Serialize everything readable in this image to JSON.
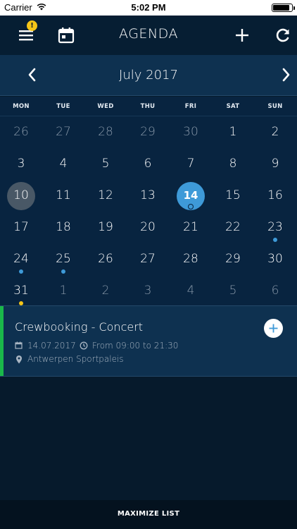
{
  "status_bar": {
    "carrier": "Carrier",
    "time": "5:02 PM"
  },
  "nav": {
    "title": "AGENDA",
    "badge": "!",
    "icons": [
      "menu-icon",
      "calendar-icon",
      "plus-icon",
      "refresh-icon"
    ]
  },
  "month": {
    "title": "July 2017"
  },
  "weekdays": [
    "MON",
    "TUE",
    "WED",
    "THU",
    "FRI",
    "SAT",
    "SUN"
  ],
  "weeks": [
    [
      {
        "n": "26",
        "other": true
      },
      {
        "n": "27",
        "other": true
      },
      {
        "n": "28",
        "other": true
      },
      {
        "n": "29",
        "other": true
      },
      {
        "n": "30",
        "other": true
      },
      {
        "n": "1"
      },
      {
        "n": "2"
      }
    ],
    [
      {
        "n": "3"
      },
      {
        "n": "4"
      },
      {
        "n": "5"
      },
      {
        "n": "6"
      },
      {
        "n": "7"
      },
      {
        "n": "8"
      },
      {
        "n": "9"
      }
    ],
    [
      {
        "n": "10",
        "today": true
      },
      {
        "n": "11"
      },
      {
        "n": "12"
      },
      {
        "n": "13"
      },
      {
        "n": "14",
        "selected": true,
        "dot": "blue"
      },
      {
        "n": "15"
      },
      {
        "n": "16"
      }
    ],
    [
      {
        "n": "17"
      },
      {
        "n": "18"
      },
      {
        "n": "19"
      },
      {
        "n": "20"
      },
      {
        "n": "21"
      },
      {
        "n": "22"
      },
      {
        "n": "23",
        "dot": "blue"
      }
    ],
    [
      {
        "n": "24",
        "dot": "blue"
      },
      {
        "n": "25",
        "dot": "blue"
      },
      {
        "n": "26"
      },
      {
        "n": "27"
      },
      {
        "n": "28"
      },
      {
        "n": "29"
      },
      {
        "n": "30"
      }
    ],
    [
      {
        "n": "31",
        "dot": "yellow"
      },
      {
        "n": "1",
        "other": true
      },
      {
        "n": "2",
        "other": true
      },
      {
        "n": "3",
        "other": true
      },
      {
        "n": "4",
        "other": true
      },
      {
        "n": "5",
        "other": true
      },
      {
        "n": "6",
        "other": true
      }
    ]
  ],
  "event": {
    "title": "Crewbooking - Concert",
    "date": "14.07.2017",
    "time": "From 09:00 to 21:30",
    "location": "Antwerpen Sportpaleis"
  },
  "footer": {
    "label": "MAXIMIZE LIST"
  },
  "colors": {
    "background": "#061a2c",
    "header": "#0e3150",
    "selected": "#3e9ad8",
    "today": "#495866",
    "dot_blue": "#3e9ad8",
    "dot_yellow": "#f5c518",
    "event_bar": "#1ab84a",
    "badge": "#f5c518"
  }
}
